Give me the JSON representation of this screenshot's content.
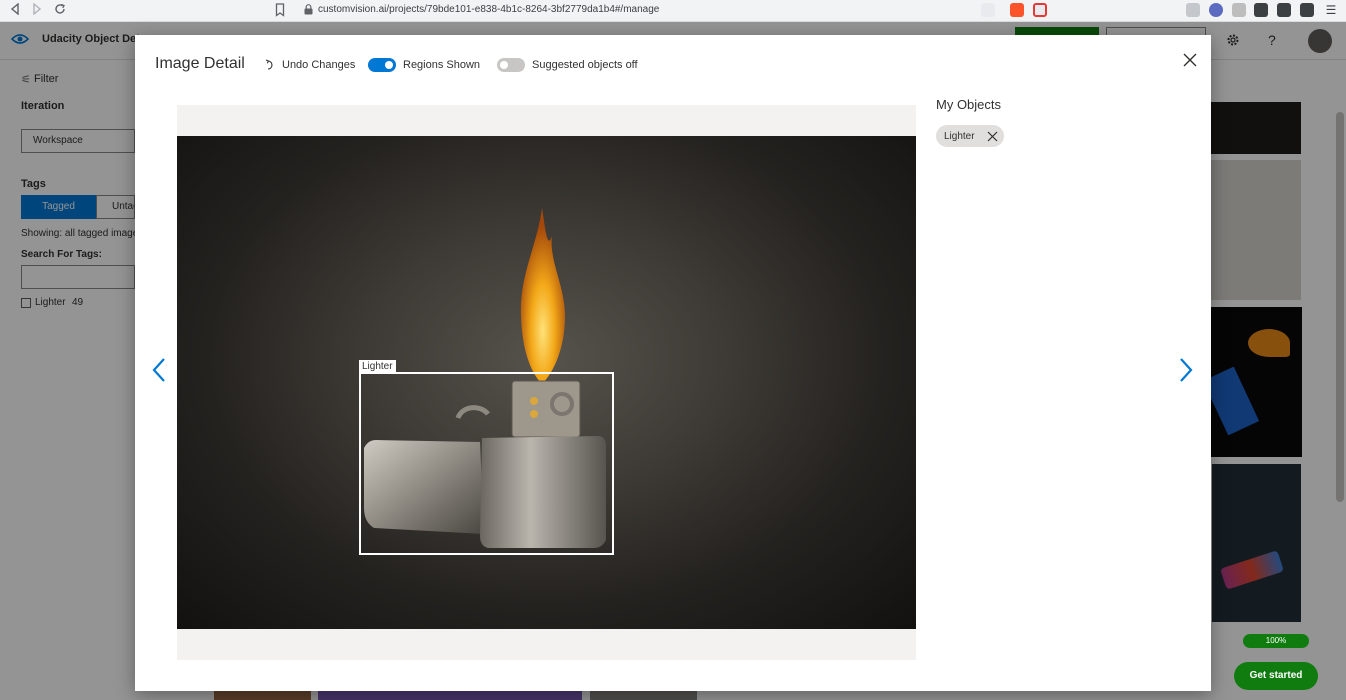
{
  "browser": {
    "url": "customvision.ai/projects/79bde101-e838-4b1c-8264-3bf2779da1b4#/manage"
  },
  "app": {
    "project_title": "Udacity Object Detec",
    "header_icons": [
      "eye-icon",
      "gear-icon",
      "help-icon",
      "avatar"
    ]
  },
  "sidebar": {
    "filter_label": "Filter",
    "iteration_label": "Iteration",
    "iteration_value": "Workspace",
    "tags_label": "Tags",
    "tab_tagged": "Tagged",
    "tab_untagged": "Untag",
    "showing_text": "Showing: all tagged image",
    "search_label": "Search For Tags:",
    "tag_name": "Lighter",
    "tag_count": "49"
  },
  "modal": {
    "title": "Image Detail",
    "undo_label": "Undo Changes",
    "regions_label": "Regions Shown",
    "regions_on": true,
    "suggested_label": "Suggested objects off",
    "suggested_on": false,
    "region_label": "Lighter",
    "objects_title": "My Objects",
    "object_chip": "Lighter"
  },
  "footer": {
    "progress": "100%",
    "get_started": "Get started"
  },
  "colors": {
    "accent": "#0078d4",
    "get_started_green": "#107c10",
    "progress_green": "#107c10"
  }
}
